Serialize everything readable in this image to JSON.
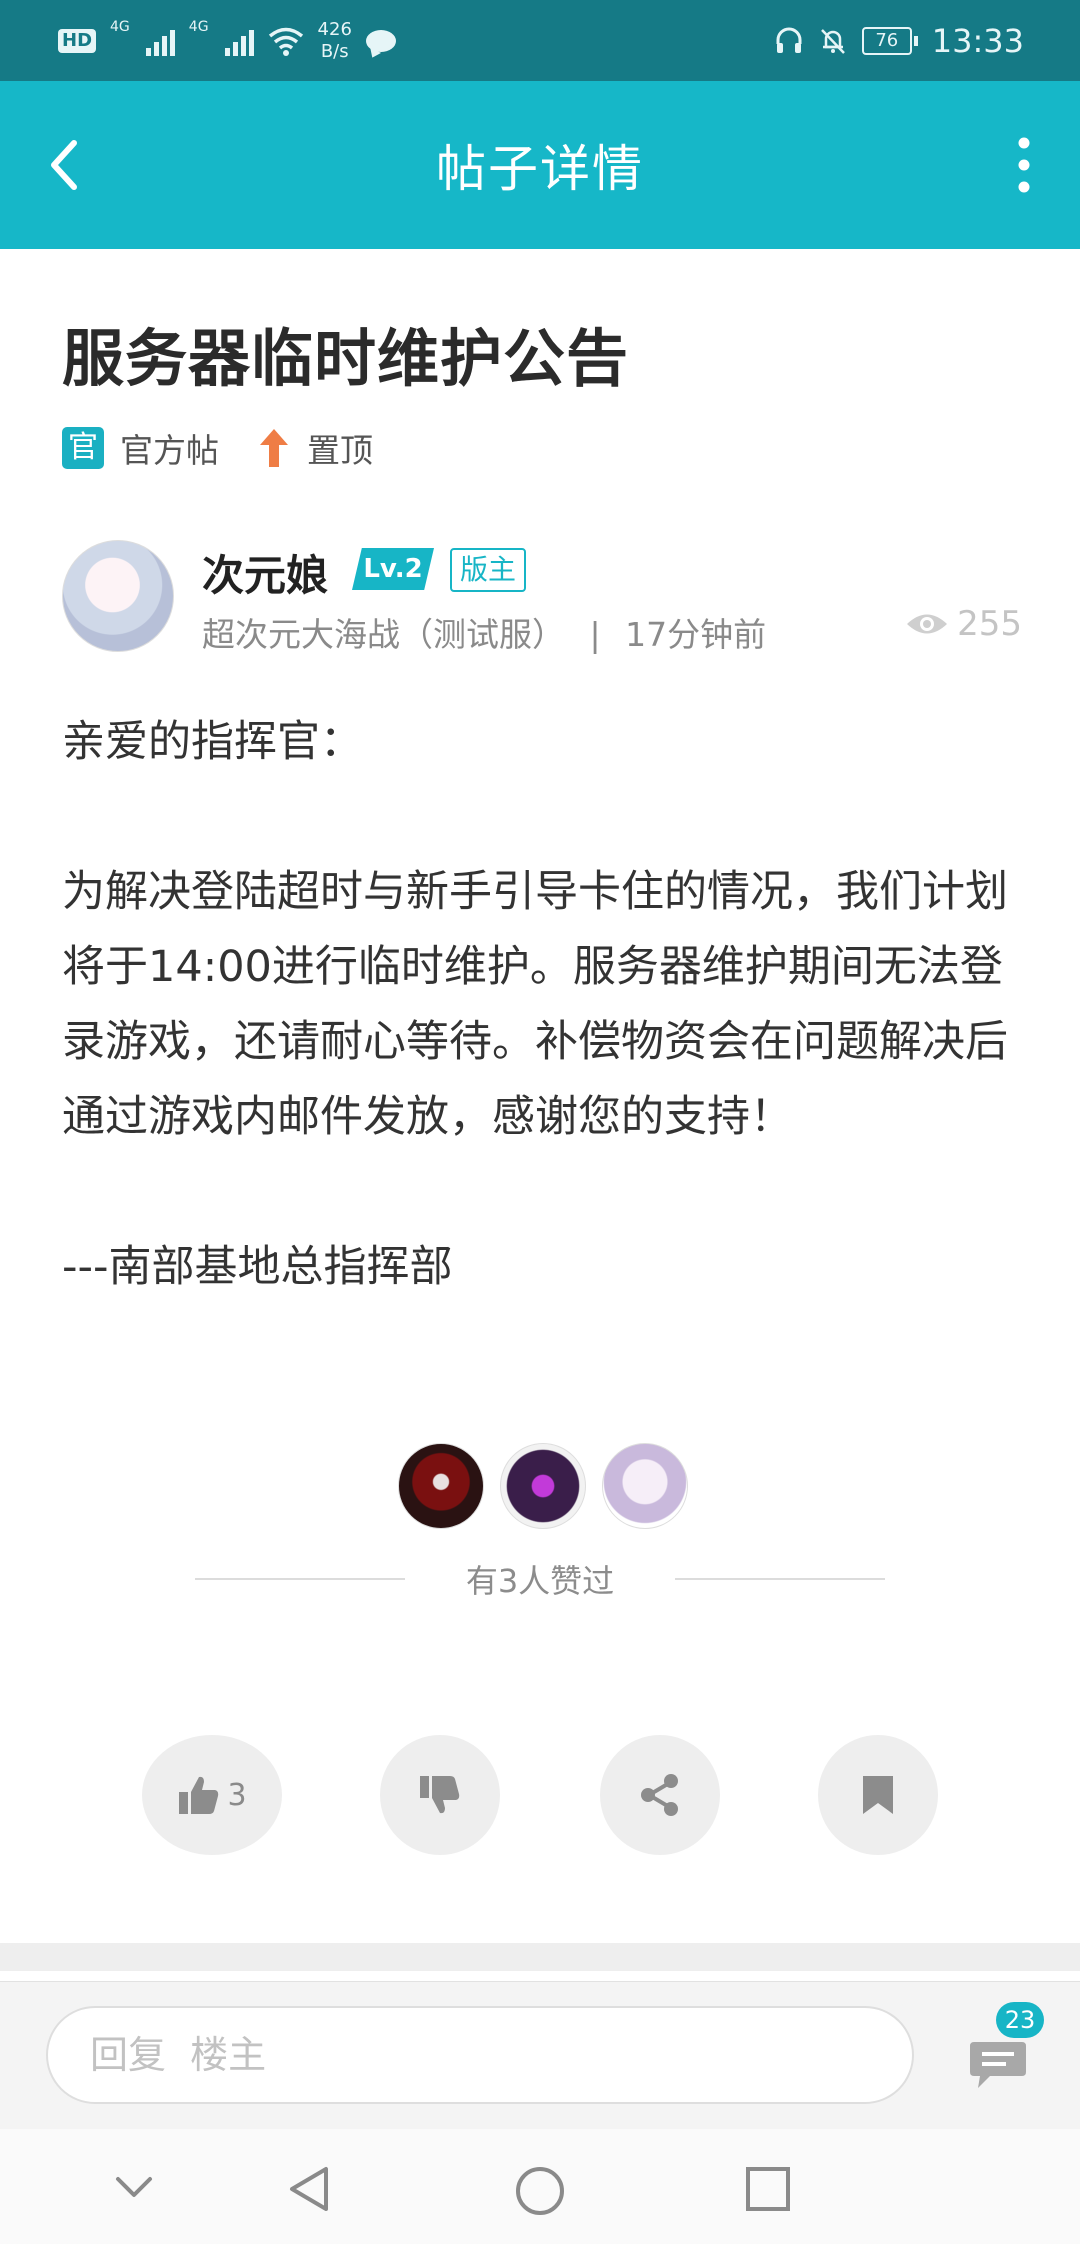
{
  "status_bar": {
    "hd": "HD",
    "net1": "4G",
    "net2": "4G",
    "speed_value": "426",
    "speed_unit": "B/s",
    "battery": "76",
    "time": "13:33"
  },
  "app_bar": {
    "title": "帖子详情",
    "back_icon": "back-arrow-icon",
    "more_icon": "more-vertical-icon"
  },
  "post": {
    "title": "服务器临时维护公告",
    "tag_official_icon_text": "官",
    "tag_official": "官方帖",
    "tag_pinned": "置顶"
  },
  "author": {
    "name": "次元娘",
    "level": "Lv.2",
    "role_badge": "版主",
    "source": "超次元大海战（测试服）",
    "separator": "|",
    "time": "17分钟前",
    "views": "255"
  },
  "content": {
    "greeting": "亲爱的指挥官：",
    "body": "为解决登陆超时与新手引导卡住的情况，我们计划将于14:00进行临时维护。服务器维护期间无法登录游戏，还请耐心等待。补偿物资会在问题解决后通过游戏内邮件发放，感谢您的支持！",
    "signature": "---南部基地总指挥部"
  },
  "likers": {
    "count_text": "有3人赞过"
  },
  "actions": {
    "like_count": "3"
  },
  "reply": {
    "placeholder": "回复  楼主",
    "comment_count": "23"
  },
  "colors": {
    "status_bar": "#157a86",
    "app_bar": "#16b7c8",
    "accent": "#17b5c6",
    "pin": "#ef7d45"
  }
}
